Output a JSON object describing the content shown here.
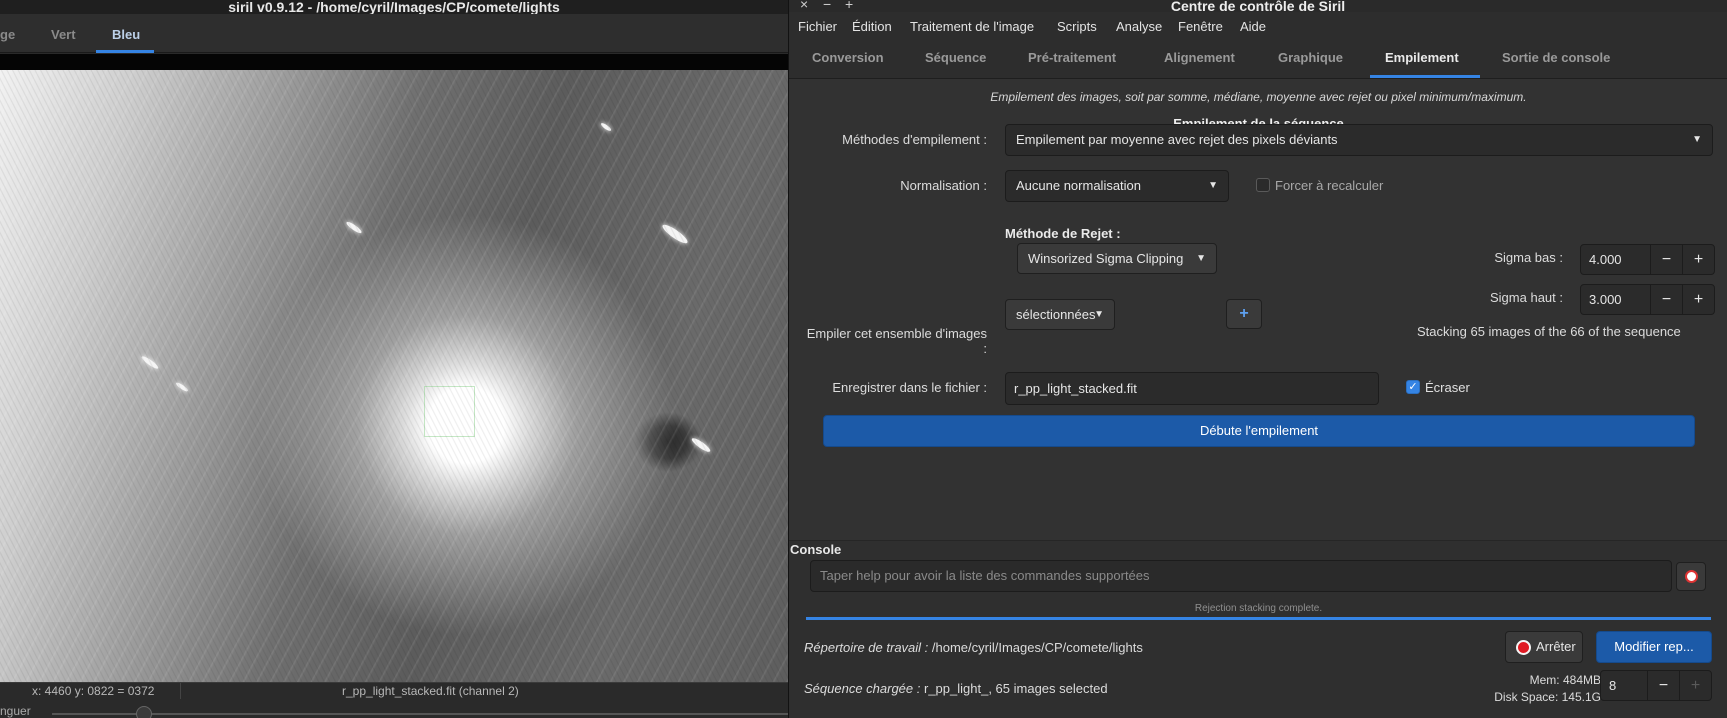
{
  "viewer": {
    "title": "siril v0.9.12 - /home/cyril/Images/CP/comete/lights",
    "tabs": [
      {
        "label": "ge"
      },
      {
        "label": "Vert"
      },
      {
        "label": "Bleu"
      }
    ],
    "status": {
      "coords": "x: 4460 y: 0822 = 0372",
      "channel": "r_pp_light_stacked.fit (channel 2)"
    },
    "bottom_label": "nguer"
  },
  "control": {
    "title": "Centre de contrôle de Siril",
    "window_buttons": {
      "close": "×",
      "minimize": "−",
      "maximize": "+"
    },
    "menu": [
      "Fichier",
      "Édition",
      "Traitement de l'image",
      "Scripts",
      "Analyse",
      "Fenêtre",
      "Aide"
    ],
    "tabs": [
      "Conversion",
      "Séquence",
      "Pré-traitement",
      "Alignement",
      "Graphique",
      "Empilement",
      "Sortie de console"
    ],
    "active_tab": "Empilement",
    "stacking": {
      "description": "Empilement des images, soit par somme, médiane, moyenne avec rejet ou pixel minimum/maximum.",
      "heading": "Empilement de la séquence",
      "method_label": "Méthodes d'empilement :",
      "method_value": "Empilement par moyenne avec rejet des pixels déviants",
      "norm_label": "Normalisation :",
      "norm_value": "Aucune normalisation",
      "force_label": "Forcer à recalculer",
      "force_checked": false,
      "rejection_heading": "Méthode de Rejet :",
      "rejection_value": "Winsorized Sigma Clipping",
      "sigma_low_label": "Sigma bas :",
      "sigma_low_value": "4.000",
      "sigma_high_label": "Sigma haut :",
      "sigma_high_value": "3.000",
      "minus": "−",
      "plus": "+",
      "set_label": "Empiler cet ensemble d'images :",
      "set_value": "sélectionnées",
      "stack_info": "Stacking 65 images of the 66 of the sequence",
      "save_label": "Enregistrer dans le fichier :",
      "save_value": "r_pp_light_stacked.fit",
      "overwrite_label": "Écraser",
      "overwrite_checked": true,
      "start_button": "Débute l'empilement"
    },
    "console": {
      "title": "Console",
      "placeholder": "Taper help pour avoir la liste des commandes supportées",
      "progress_text": "Rejection stacking complete.",
      "progress": 1.0,
      "workdir_label": "Répertoire de travail :",
      "workdir_value": "/home/cyril/Images/CP/comete/lights",
      "stop_button": "Arrêter",
      "modify_button": "Modifier rep...",
      "seq_label": "Séquence chargée :",
      "seq_value": "r_pp_light_, 65 images selected",
      "mem": "Mem: 484MB",
      "disk": "Disk Space: 145.1G",
      "threads": "8"
    }
  }
}
